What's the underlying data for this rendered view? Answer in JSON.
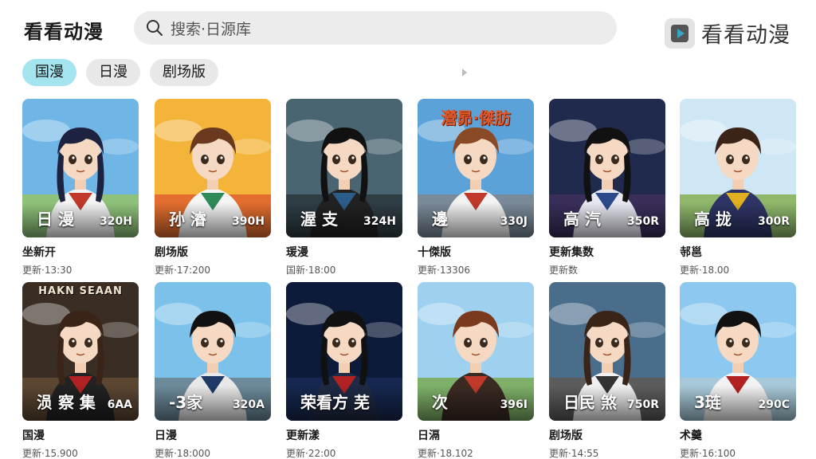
{
  "app": {
    "title": "看看动漫",
    "brand_name": "看看动漫"
  },
  "search": {
    "text": "搜索·日源库"
  },
  "tabs": [
    {
      "label": "国漫",
      "active": true
    },
    {
      "label": "日漫",
      "active": false
    },
    {
      "label": "剧场版",
      "active": false
    }
  ],
  "colors": {
    "active_tab": "#a3e4ee",
    "search_bg": "#ececec",
    "tab_bg": "#e8e8e8"
  },
  "cards": [
    {
      "overlay_title": "日 漫",
      "overlay_count": "320H",
      "title": "坐新开",
      "sub": "更新·13:30",
      "poster_text": ""
    },
    {
      "overlay_title": "孙 濬",
      "overlay_count": "390H",
      "title": "剧场版",
      "sub": "更新·17:200",
      "poster_text": ""
    },
    {
      "overlay_title": "渥 支",
      "overlay_count": "324H",
      "title": "瑗漫",
      "sub": "国新·18:00",
      "poster_text": ""
    },
    {
      "overlay_title": "邊",
      "overlay_count": "330J",
      "title": "十傑版",
      "sub": "更新·13306",
      "poster_text": "瀯昴·傑肪"
    },
    {
      "overlay_title": "高 汽",
      "overlay_count": "350R",
      "title": "更新集数",
      "sub": "更新数",
      "poster_text": ""
    },
    {
      "overlay_title": "高 拢",
      "overlay_count": "300R",
      "title": "邿邕",
      "sub": "更新·18.00",
      "poster_text": ""
    },
    {
      "overlay_title": "涢 察 集",
      "overlay_count": "6AA",
      "title": "国漫",
      "sub": "更新·15.900",
      "poster_text": "HAKN SEAAN"
    },
    {
      "overlay_title": "-3家",
      "overlay_count": "320A",
      "title": "日漫",
      "sub": "更新·18:000",
      "poster_text": ""
    },
    {
      "overlay_title": "荣看方 芜",
      "overlay_count": "",
      "title": "更新漾",
      "sub": "更新·22:00",
      "poster_text": ""
    },
    {
      "overlay_title": "次",
      "overlay_count": "396I",
      "title": "日滆",
      "sub": "更新·18.102",
      "poster_text": ""
    },
    {
      "overlay_title": "日民 煞",
      "overlay_count": "750R",
      "title": "剧场版",
      "sub": "更新·14:55",
      "poster_text": ""
    },
    {
      "overlay_title": "3琏",
      "overlay_count": "290C",
      "title": "术羹",
      "sub": "更新·16:100",
      "poster_text": ""
    }
  ]
}
